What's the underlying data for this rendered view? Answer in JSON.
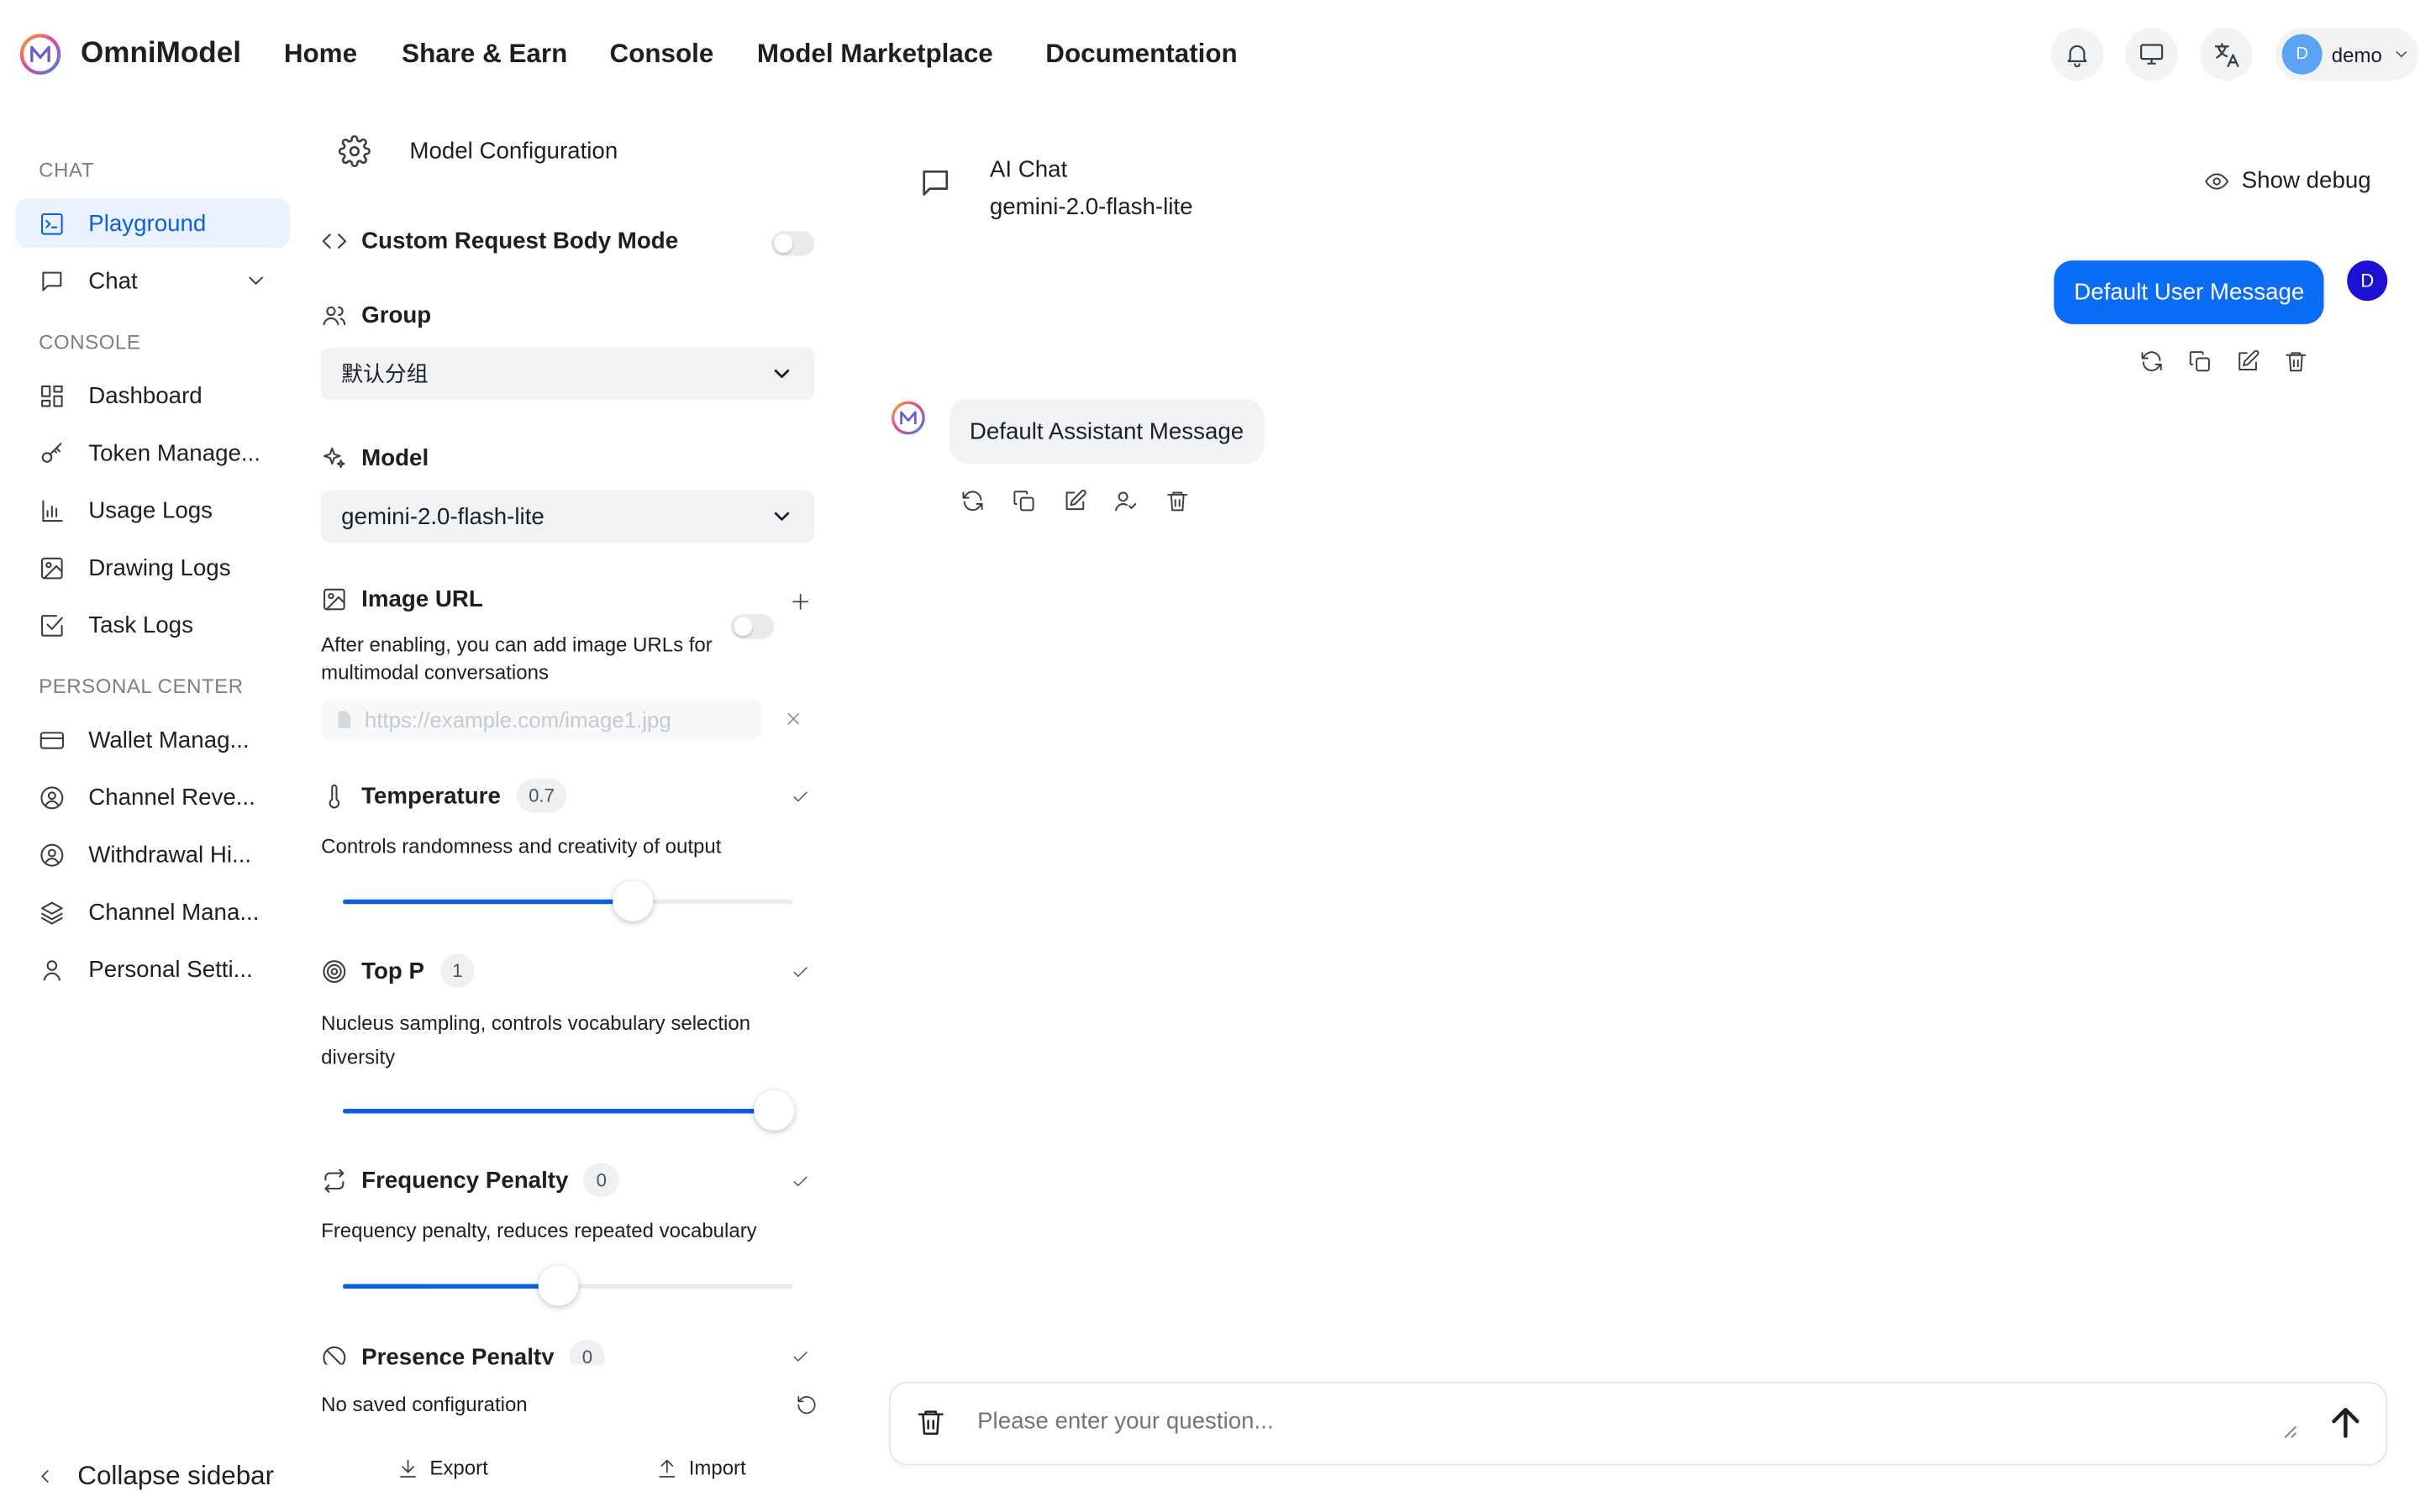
{
  "header": {
    "brand": "OmniModel",
    "nav": [
      "Home",
      "Share & Earn",
      "Console",
      "Model Marketplace",
      "Documentation"
    ],
    "user": {
      "initial": "D",
      "name": "demo"
    }
  },
  "sidebar": {
    "chat_title": "CHAT",
    "playground": "Playground",
    "chat": "Chat",
    "console_title": "CONSOLE",
    "console_items": [
      "Dashboard",
      "Token Manage...",
      "Usage Logs",
      "Drawing Logs",
      "Task Logs"
    ],
    "personal_title": "PERSONAL CENTER",
    "personal_items": [
      "Wallet Manag...",
      "Channel Reve...",
      "Withdrawal Hi...",
      "Channel Mana...",
      "Personal Setti..."
    ],
    "collapse": "Collapse sidebar"
  },
  "config": {
    "title": "Model Configuration",
    "custom_body": "Custom Request Body Mode",
    "group_label": "Group",
    "group_value": "默认分组",
    "model_label": "Model",
    "model_value": "gemini-2.0-flash-lite",
    "image_url_label": "Image URL",
    "image_url_desc": "After enabling, you can add image URLs for multimodal conversations",
    "image_url_placeholder": "https://example.com/image1.jpg",
    "temperature": {
      "label": "Temperature",
      "value": "0.7",
      "desc": "Controls randomness and creativity of output",
      "fill": 0.67
    },
    "top_p": {
      "label": "Top P",
      "value": "1",
      "desc": "Nucleus sampling, controls vocabulary selection diversity",
      "fill": 1.0
    },
    "frequency_penalty": {
      "label": "Frequency Penalty",
      "value": "0",
      "desc": "Frequency penalty, reduces repeated vocabulary",
      "fill": 0.5
    },
    "presence_penalty": {
      "label": "Presence Penalty",
      "value": "0"
    },
    "saved_status": "No saved configuration",
    "export": "Export",
    "import": "Import"
  },
  "chat": {
    "title": "AI Chat",
    "model": "gemini-2.0-flash-lite",
    "debug": "Show debug",
    "user_message": "Default User Message",
    "user_initial": "D",
    "assistant_message": "Default Assistant Message",
    "input_placeholder": "Please enter your question..."
  },
  "colors": {
    "accent": "#0b6cf5",
    "active_bg": "#eaf2ff",
    "user_avatar": "#1b12d6"
  }
}
